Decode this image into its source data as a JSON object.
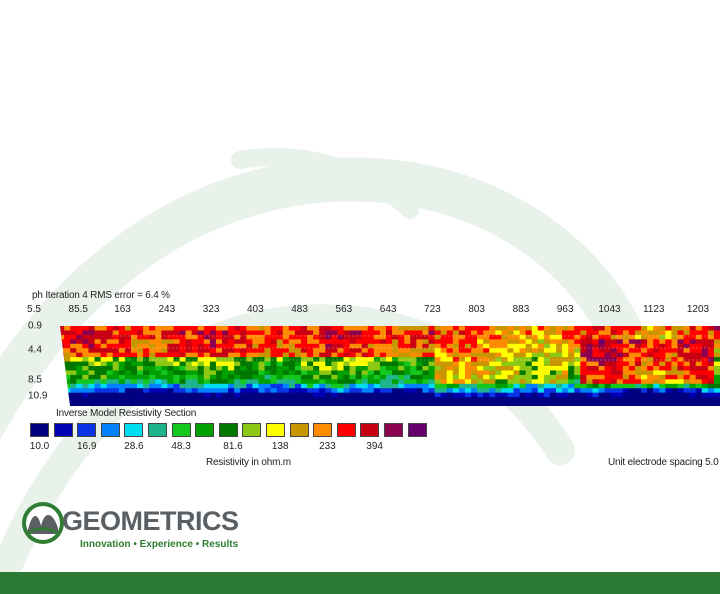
{
  "header": {
    "profile": "ph",
    "iteration": "Iteration 4 RMS error = 6.4 %"
  },
  "colors": {
    "footer_bar": "#2d7a34",
    "logo_gray": "#5a5f63",
    "logo_green": "#2e7d32",
    "watermark": "#e8f1ea"
  },
  "logo": {
    "name": "GEOMETRICS",
    "tagline": "Innovation • Experience • Results"
  },
  "chart_data": {
    "type": "heatmap",
    "title": "Inverse Model Resistivity Section",
    "x_ticks": [
      "5.5",
      "85.5",
      "163",
      "243",
      "323",
      "403",
      "483",
      "563",
      "643",
      "723",
      "803",
      "883",
      "963",
      "1043",
      "1123",
      "1203"
    ],
    "x_range": [
      0,
      1220
    ],
    "depth_ticks": [
      "0.9",
      "4.4",
      "8.5",
      "10.9"
    ],
    "depth_range": [
      0,
      12
    ],
    "colorbar": {
      "label": "Resistivity in ohm.m",
      "tick_labels": [
        "10.0",
        "16.9",
        "28.6",
        "48.3",
        "81.6",
        "138",
        "233",
        "394"
      ],
      "colors": [
        "#000080",
        "#0000b4",
        "#0a32e6",
        "#0082ff",
        "#00dcf0",
        "#1eb48c",
        "#14c81e",
        "#00a000",
        "#007800",
        "#8cc814",
        "#ffff00",
        "#c89600",
        "#ff8c00",
        "#ff0000",
        "#c80014",
        "#8c0050",
        "#64006e"
      ]
    },
    "zones": [
      {
        "x": [
          5.5,
          700
        ],
        "depth": [
          0.9,
          4.4
        ],
        "level": "high",
        "resistivity_range_ohm_m": [
          138,
          394
        ]
      },
      {
        "x": [
          700,
          940
        ],
        "depth": [
          0.9,
          10.9
        ],
        "level": "medium-high",
        "resistivity_range_ohm_m": [
          81.6,
          233
        ]
      },
      {
        "x": [
          960,
          1210
        ],
        "depth": [
          2.0,
          9.0
        ],
        "level": "very high",
        "resistivity_range_ohm_m": [
          233,
          394
        ]
      },
      {
        "x": [
          5.5,
          1210
        ],
        "depth": [
          8.5,
          10.9
        ],
        "level": "low",
        "resistivity_range_ohm_m": [
          10.0,
          48.3
        ]
      }
    ],
    "footer_note": "Unit electrode spacing 5.0"
  }
}
